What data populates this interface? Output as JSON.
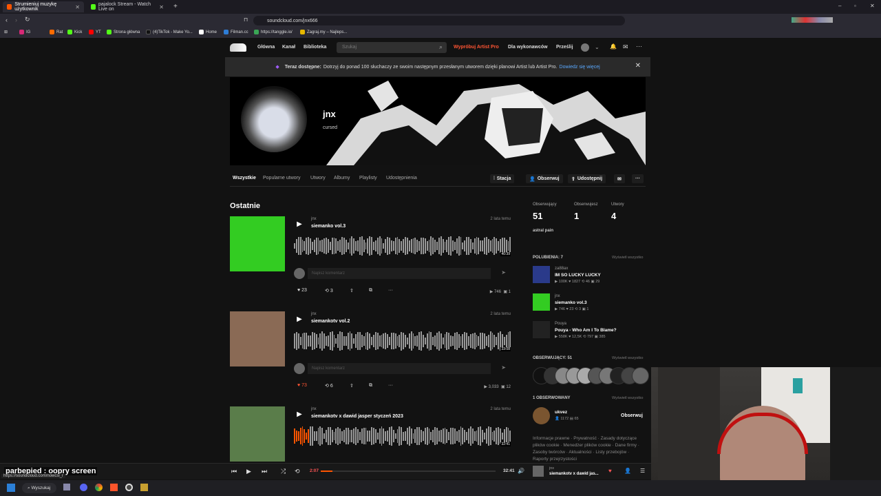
{
  "browser": {
    "tabs": [
      {
        "label": "Strumieniuj muzykę użytkownik",
        "color": "#ff5500",
        "active": true
      },
      {
        "label": "pajalock Stream - Watch Live on",
        "color": "#53fc18",
        "active": false
      }
    ],
    "url": "soundcloud.com/jnx666",
    "bookmarks": [
      {
        "label": "IG",
        "color": "#d62976"
      },
      {
        "label": "Rat",
        "color": "#ff6b00"
      },
      {
        "label": "Kick",
        "color": "#53fc18"
      },
      {
        "label": "YT",
        "color": "#ff0000"
      },
      {
        "label": "Strona główna",
        "color": "#53fc18"
      },
      {
        "label": "(4)TikTok - Make Yo...",
        "color": "#111111"
      },
      {
        "label": "Home",
        "color": "#ffffff"
      },
      {
        "label": "Filman.cc",
        "color": "#2e7dd7"
      },
      {
        "label": "https://tanggle.io/",
        "color": "#3aa655"
      },
      {
        "label": "Zagraj.my – Najleps...",
        "color": "#e6b800"
      }
    ],
    "status_url": "https://soundcloud.com/nowcsi_r"
  },
  "nav": {
    "home": "Główna",
    "feed": "Kanał",
    "library": "Biblioteka",
    "search_placeholder": "Szukaj",
    "try_pro": "Wypróbuj Artist Pro",
    "for_artists": "Dla wykonawców",
    "upload": "Prześlij"
  },
  "banner": {
    "bold": "Teraz dostępne:",
    "text": "Dotrzyj do ponad 100 słuchaczy ze swoim następnym przesłanym utworem dzięki planowi Artist lub Artist Pro.",
    "link": "Dowiedz się więcej"
  },
  "profile": {
    "name": "jnx",
    "city": "cursed"
  },
  "profile_tabs": [
    "Wszystkie",
    "Popularne utwory",
    "Utwory",
    "Albumy",
    "Playlisty",
    "Udostępnienia"
  ],
  "profile_actions": {
    "station": "Stacja",
    "follow": "Obserwuj",
    "share": "Udostępnij"
  },
  "recent_heading": "Ostatnie",
  "comment_placeholder": "Napisz komentarz",
  "tracks": [
    {
      "user": "jnx",
      "title": "siemanko vol.3",
      "date": "2 lata temu",
      "likes": "23",
      "reposts": "3",
      "plays": "746",
      "comments": "1",
      "duration": "40:39",
      "art": "#33cc22",
      "liked": false
    },
    {
      "user": "jnx",
      "title": "siemankotv vol.2",
      "date": "2 lata temu",
      "likes": "73",
      "reposts": "6",
      "plays": "3,033",
      "comments": "12",
      "duration": "33:08",
      "art": "#8a6a55",
      "liked": true
    },
    {
      "user": "jnx",
      "title": "siemankotv x dawid jasper styczeń 2023",
      "date": "2 lata temu",
      "likes": "",
      "reposts": "",
      "plays": "",
      "comments": "",
      "duration": "32:41",
      "elapsed": "2:07",
      "art": "#5a7d4a",
      "liked": false
    }
  ],
  "stats": [
    {
      "label": "Obserwujący",
      "value": "51"
    },
    {
      "label": "Obserwujesz",
      "value": "1"
    },
    {
      "label": "Utwory",
      "value": "4"
    }
  ],
  "bio": "astral pain",
  "likes_section": {
    "heading": "POLUBIENIA: 7",
    "view_all": "Wyświetl wszystko"
  },
  "likes": [
    {
      "user": "za88ax",
      "title": "IM SO LUCKY LUCKY",
      "stats": "▶ 100K  ♥ 1827  ⟲ 46  ▣ 29",
      "color": "#2a3a8a"
    },
    {
      "user": "jnx",
      "title": "siemanko vol.3",
      "stats": "▶ 746  ♥ 23  ⟲ 3  ▣ 1",
      "color": "#33cc22"
    },
    {
      "user": "Pouya",
      "title": "Pouya - Who Am I To Blame?",
      "stats": "▶ 558K  ♥ 12,5K  ⟲ 797  ▣ 385",
      "color": "#222222"
    }
  ],
  "followers_section": {
    "heading": "OBSERWUJĄCY: 51",
    "view_all": "Wyświetl wszystko"
  },
  "following_section": {
    "heading": "1 OBSERWOWANY",
    "view_all": "Wyświetl wszystko"
  },
  "following": {
    "user": "ukvez",
    "stats": "👤 1172  ▤ 65",
    "button": "Obserwuj"
  },
  "footer_links": "Informacje prawne · Prywatność · Zasady dotyczące plików cookie · Menedżer plików cookie · Dane firmy · Zasoby twórców · Aktualności · Listy przebojów · Raporty przejrzystości",
  "player": {
    "elapsed": "2:07",
    "duration": "32:41",
    "artist": "jnx",
    "title": "siemankotv x dawid jas...",
    "progress": 0.065
  },
  "overlay_text": "parbepied : oopry screen",
  "taskbar": {
    "search": "Wyszukaj"
  }
}
